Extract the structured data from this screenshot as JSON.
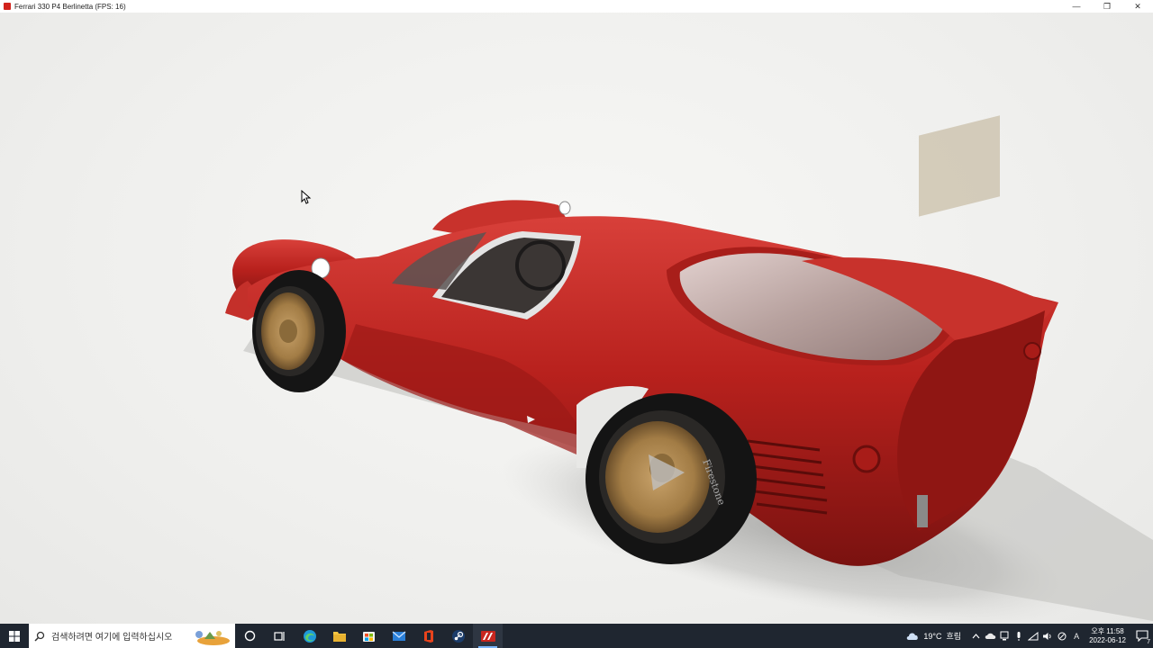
{
  "window": {
    "title": "Ferrari 330 P4 Berlinetta (FPS: 16)",
    "minimize_glyph": "—",
    "restore_glyph": "❐",
    "close_glyph": "✕"
  },
  "viewport": {
    "subject": "ferrari-330-p4-3d-model",
    "tyre_brand": "Firestone",
    "colors": {
      "body": "#b8211d",
      "background": "#efefed",
      "wheel": "#b08850"
    }
  },
  "taskbar": {
    "search_placeholder": "검색하려면 여기에 입력하십시오",
    "apps": [
      {
        "name": "task-view",
        "icon": "task-view-icon"
      },
      {
        "name": "edge",
        "icon": "edge-icon"
      },
      {
        "name": "file-explorer",
        "icon": "folder-icon"
      },
      {
        "name": "microsoft-store",
        "icon": "store-icon"
      },
      {
        "name": "mail",
        "icon": "mail-icon"
      },
      {
        "name": "office",
        "icon": "office-icon"
      },
      {
        "name": "steam",
        "icon": "steam-icon"
      },
      {
        "name": "car-viewer",
        "icon": "car-viewer-icon"
      }
    ],
    "weather": {
      "temp": "19°C",
      "condition": "흐림"
    },
    "clock": {
      "time": "오후 11:58",
      "date": "2022-06-12"
    },
    "notification_count": "7",
    "ime_label": "A"
  }
}
